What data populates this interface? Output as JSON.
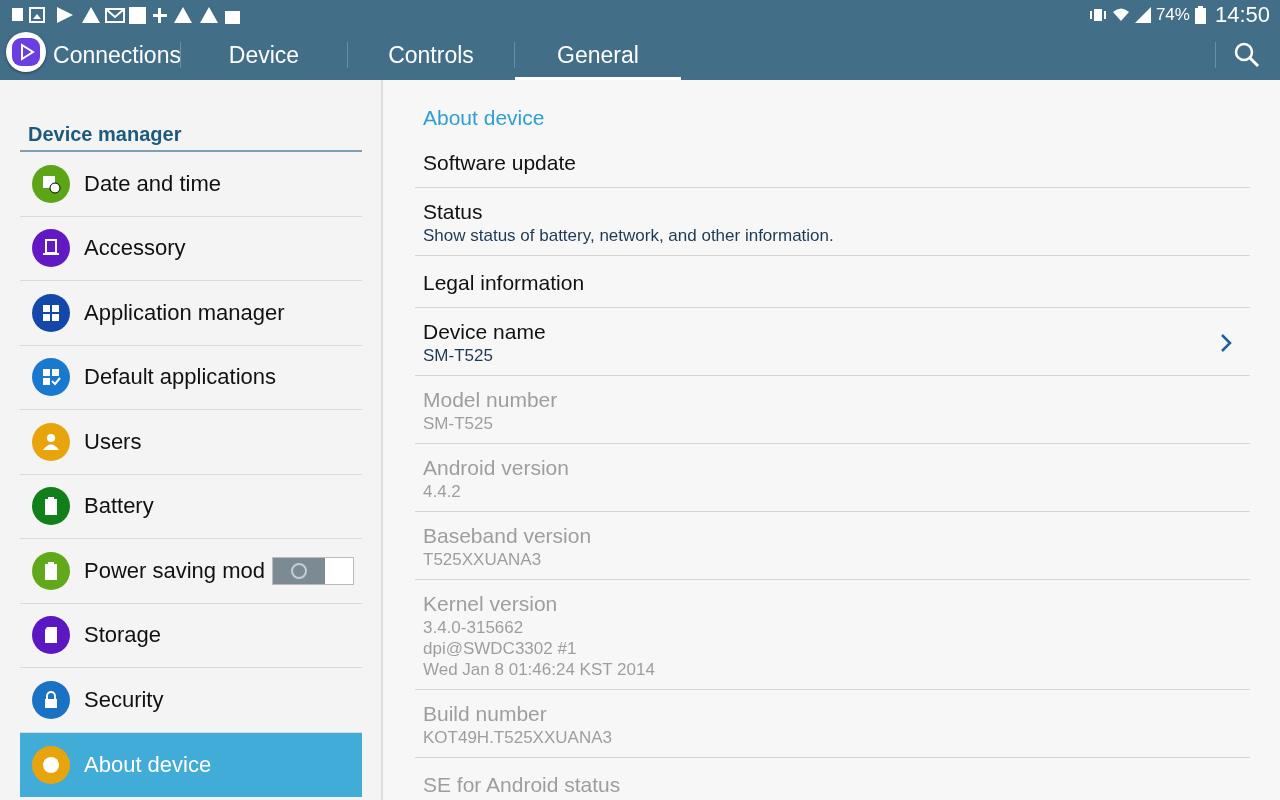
{
  "status_bar": {
    "battery": "74%",
    "time": "14:50"
  },
  "tabs": [
    {
      "label": "Connections",
      "selected": false
    },
    {
      "label": "Device",
      "selected": false
    },
    {
      "label": "Controls",
      "selected": false
    },
    {
      "label": "General",
      "selected": true
    }
  ],
  "sidebar": {
    "section_title": "Device manager",
    "items": [
      {
        "label": "Date and time",
        "color": "#5ba516",
        "selected": false
      },
      {
        "label": "Accessory",
        "color": "#6219c3",
        "selected": false
      },
      {
        "label": "Application manager",
        "color": "#1448a8",
        "selected": false
      },
      {
        "label": "Default applications",
        "color": "#1979cf",
        "selected": false
      },
      {
        "label": "Users",
        "color": "#e8a40c",
        "selected": false
      },
      {
        "label": "Battery",
        "color": "#12801a",
        "selected": false
      },
      {
        "label": "Power saving mod",
        "color": "#62a81b",
        "selected": false,
        "kind": "toggle",
        "on": false
      },
      {
        "label": "Storage",
        "color": "#5b17c1",
        "selected": false
      },
      {
        "label": "Security",
        "color": "#1a72c4",
        "selected": false
      },
      {
        "label": "About device",
        "color": "#e8a40c",
        "selected": true
      }
    ]
  },
  "content": {
    "section_title": "About device",
    "rows": [
      {
        "title": "Software update",
        "disabled": false,
        "chevron": false
      },
      {
        "title": "Status",
        "subtitle": [
          "Show status of battery, network, and other information."
        ],
        "disabled": false,
        "chevron": false
      },
      {
        "title": "Legal information",
        "disabled": false,
        "chevron": false
      },
      {
        "title": "Device name",
        "subtitle": [
          "SM-T525"
        ],
        "disabled": false,
        "chevron": true
      },
      {
        "title": "Model number",
        "subtitle": [
          "SM-T525"
        ],
        "disabled": true,
        "chevron": false
      },
      {
        "title": "Android version",
        "subtitle": [
          "4.4.2"
        ],
        "disabled": true,
        "chevron": false
      },
      {
        "title": "Baseband version",
        "subtitle": [
          "T525XXUANA3"
        ],
        "disabled": true,
        "chevron": false
      },
      {
        "title": "Kernel version",
        "subtitle": [
          "3.4.0-315662",
          "dpi@SWDC3302 #1",
          "Wed Jan 8 01:46:24 KST 2014"
        ],
        "disabled": true,
        "chevron": false
      },
      {
        "title": "Build number",
        "subtitle": [
          "KOT49H.T525XXUANA3"
        ],
        "disabled": true,
        "chevron": false
      },
      {
        "title": "SE for Android status",
        "disabled": true,
        "chevron": false
      }
    ]
  }
}
